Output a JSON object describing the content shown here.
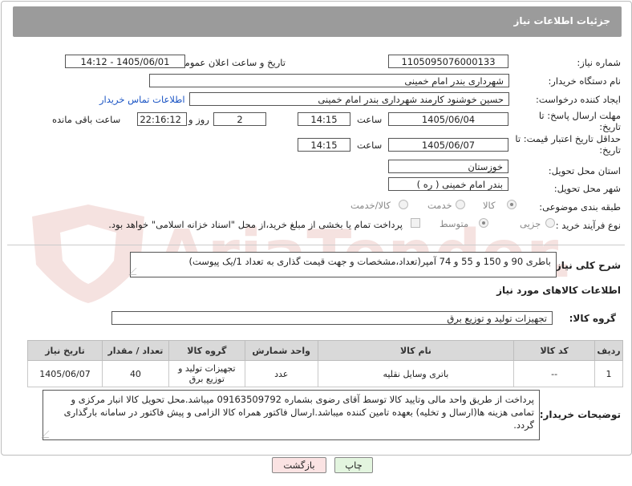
{
  "header": {
    "title": "جزئیات اطلاعات نیاز"
  },
  "fields": {
    "need_number_label": "شماره نیاز:",
    "need_number": "1105095076000133",
    "announce_label": "تاریخ و ساعت اعلان عمومی:",
    "announce_value": "1405/06/01 - 14:12",
    "buyer_org_label": "نام دستگاه خریدار:",
    "buyer_org": "شهرداری بندر امام خمینی",
    "requester_label": "ایجاد کننده درخواست:",
    "requester": "حسین خوشنود کارمند شهرداری بندر امام خمینی",
    "contact_link": "اطلاعات تماس خریدار",
    "reply_deadline_label": "مهلت ارسال پاسخ: تا تاریخ:",
    "reply_date": "1405/06/04",
    "time_label": "ساعت",
    "reply_time": "14:15",
    "days_value": "2",
    "days_label": "روز و",
    "remaining_time": "22:16:12",
    "remaining_label": "ساعت باقی مانده",
    "price_validity_label": "حداقل تاریخ اعتبار قیمت: تا تاریخ:",
    "price_date": "1405/06/07",
    "price_time": "14:15",
    "province_label": "استان محل تحویل:",
    "province": "خوزستان",
    "city_label": "شهر محل تحویل:",
    "city": "بندر امام خمینی ( ره )",
    "category_label": "طبقه بندی موضوعی:",
    "category_options": [
      "کالا",
      "خدمت",
      "کالا/خدمت"
    ],
    "process_label": "نوع فرآیند خرید :",
    "process_options": [
      "جزیی",
      "متوسط"
    ],
    "payment_note": "پرداخت تمام یا بخشی از مبلغ خرید،از محل \"اسناد خزانه اسلامی\" خواهد بود."
  },
  "summary": {
    "label": "شرح کلی نیاز:",
    "text": "باطری 90 و 150 و 55 و 74 آمپر(تعداد،مشخصات و جهت قیمت گذاری به تعداد 1/یک پیوست)"
  },
  "goods_section": {
    "title": "اطلاعات کالاهای مورد نیاز",
    "group_label": "گروه کالا:",
    "group_value": "تجهیزات تولید و توزیع برق"
  },
  "table": {
    "columns": [
      "ردیف",
      "کد کالا",
      "نام کالا",
      "واحد شمارش",
      "گروه کالا",
      "تعداد / مقدار",
      "تاریخ نیاز"
    ],
    "rows": [
      [
        "1",
        "--",
        "باتری وسایل نقلیه",
        "عدد",
        "تجهیزات تولید و توزیع برق",
        "40",
        "1405/06/07"
      ]
    ]
  },
  "buyer_notes": {
    "label": "توضیحات خریدار:",
    "text": "پرداخت از طریق واحد مالی وتایید کالا توسط آقای رضوی بشماره 09163509792 میباشد.محل تحویل کالا انبار مرکزی و تمامی هزینه ها(ارسال و تخلیه) بعهده تامین کننده میباشد.ارسال فاکتور همراه کالا الزامی و پیش فاکتور در سامانه بارگذاری گردد."
  },
  "buttons": {
    "print": "چاپ",
    "back": "بازگشت"
  },
  "watermark": "AriaTender.neT",
  "colors": {
    "header_bg": "#9b9b9b",
    "link": "#1a54c4",
    "back_btn_bg": "#fbe3e3",
    "print_btn_bg": "#e3f5df",
    "watermark": "#c0392b"
  }
}
